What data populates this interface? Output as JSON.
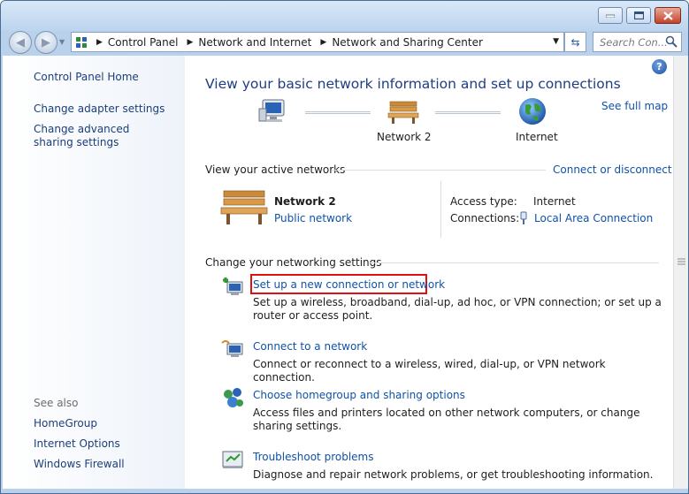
{
  "window": {
    "controls": {
      "minimize": "minimize",
      "maximize": "maximize",
      "close": "close"
    }
  },
  "address": {
    "crumbs": [
      "Control Panel",
      "Network and Internet",
      "Network and Sharing Center"
    ],
    "search_placeholder": "Search Con..."
  },
  "sidebar": {
    "links": [
      {
        "label": "Control Panel Home"
      },
      {
        "label": "Change adapter settings"
      },
      {
        "label": "Change advanced sharing settings"
      }
    ],
    "see_also_header": "See also",
    "see_also": [
      {
        "label": "HomeGroup"
      },
      {
        "label": "Internet Options"
      },
      {
        "label": "Windows Firewall"
      }
    ]
  },
  "main": {
    "title": "View your basic network information and set up connections",
    "see_full_map": "See full map",
    "map": {
      "node2_label": "Network  2",
      "node3_label": "Internet"
    },
    "active_networks": {
      "header": "View your active networks",
      "connect_link": "Connect or disconnect",
      "network_name": "Network  2",
      "network_type": "Public network",
      "access_type_label": "Access type:",
      "access_type_value": "Internet",
      "connections_label": "Connections:",
      "connections_value": "Local Area Connection"
    },
    "settings": {
      "header": "Change your networking settings",
      "tasks": [
        {
          "title": "Set up a new connection or network",
          "desc": "Set up a wireless, broadband, dial-up, ad hoc, or VPN connection; or set up a router or access point."
        },
        {
          "title": "Connect to a network",
          "desc": "Connect or reconnect to a wireless, wired, dial-up, or VPN network connection."
        },
        {
          "title": "Choose homegroup and sharing options",
          "desc": "Access files and printers located on other network computers, or change sharing settings."
        },
        {
          "title": "Troubleshoot problems",
          "desc": "Diagnose and repair network problems, or get troubleshooting information."
        }
      ]
    }
  },
  "colors": {
    "highlight": "#e21010",
    "link": "#0f52a8",
    "title": "#1e3d82"
  }
}
